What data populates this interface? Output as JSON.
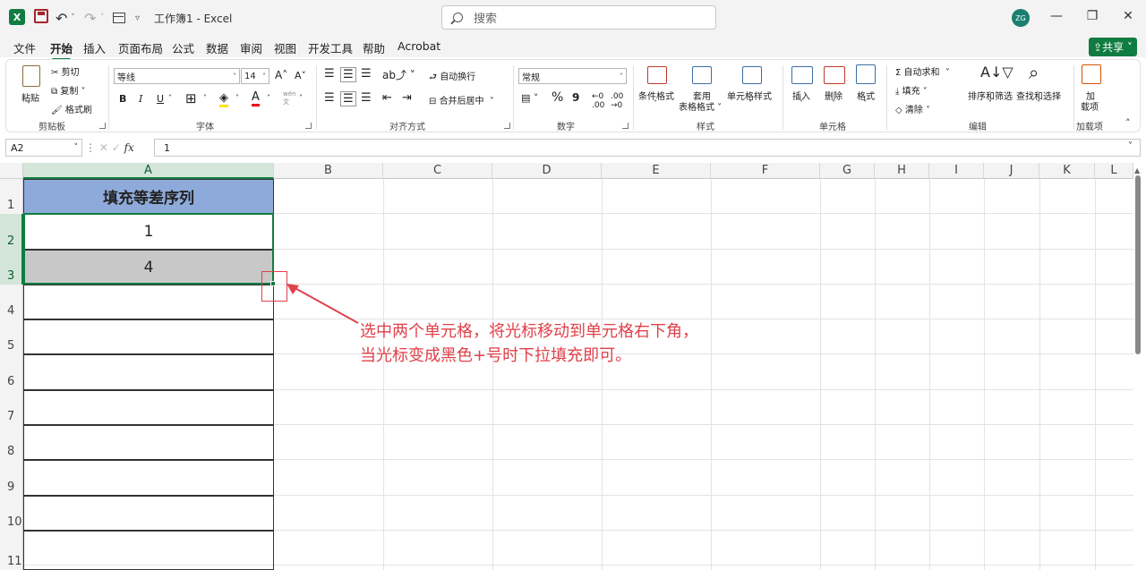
{
  "titlebar": {
    "logo": "X",
    "title": "工作簿1 - Excel",
    "search_placeholder": "搜索",
    "avatar": "ZG",
    "minimize": "—",
    "restore": "❐",
    "close": "✕"
  },
  "tabs": [
    "文件",
    "开始",
    "插入",
    "页面布局",
    "公式",
    "数据",
    "审阅",
    "视图",
    "开发工具",
    "帮助",
    "Acrobat"
  ],
  "active_tab": "开始",
  "share": "⇪共享 ˅",
  "ribbon": {
    "clipboard": {
      "paste": "粘贴",
      "cut": "剪切",
      "copy": "复制",
      "format_painter": "格式刷",
      "label": "剪贴板"
    },
    "font": {
      "name": "等线",
      "size": "14",
      "grow": "A˄",
      "shrink": "A˅",
      "bold": "B",
      "italic": "I",
      "underline": "U",
      "label": "字体"
    },
    "alignment": {
      "wrap": "自动换行",
      "merge": "合并后居中",
      "label": "对齐方式"
    },
    "number": {
      "format": "常规",
      "percent": "%",
      "comma": "9",
      "label": "数字"
    },
    "styles": {
      "conditional": "条件格式",
      "table_format_1": "套用",
      "table_format_2": "表格格式",
      "cell_styles": "单元格样式",
      "label": "样式"
    },
    "cells": {
      "insert": "插入",
      "delete": "删除",
      "format": "格式",
      "label": "单元格"
    },
    "editing": {
      "autosum": "自动求和",
      "fill": "填充",
      "clear": "清除",
      "sort": "排序和筛选",
      "find": "查找和选择",
      "label": "编辑"
    },
    "addins": {
      "label_1": "加",
      "label_2": "载项",
      "label": "加载项"
    }
  },
  "formula_bar": {
    "name_box": "A2",
    "fx": "fx",
    "value": "1"
  },
  "columns": [
    "A",
    "B",
    "C",
    "D",
    "E",
    "F",
    "G",
    "H",
    "I",
    "J",
    "K",
    "L"
  ],
  "rows": [
    "1",
    "2",
    "3",
    "4",
    "5",
    "6",
    "7",
    "8",
    "9",
    "10",
    "11"
  ],
  "cells": {
    "A1": "填充等差序列",
    "A2": "1",
    "A3": "4"
  },
  "annotation": {
    "line1": "选中两个单元格，将光标移动到单元格右下角，",
    "line2": "当光标变成黑色+号时下拉填充即可。"
  },
  "colors": {
    "excel_green": "#107c41",
    "header_fill": "#8eaadb",
    "annotation_red": "#e0414a"
  }
}
